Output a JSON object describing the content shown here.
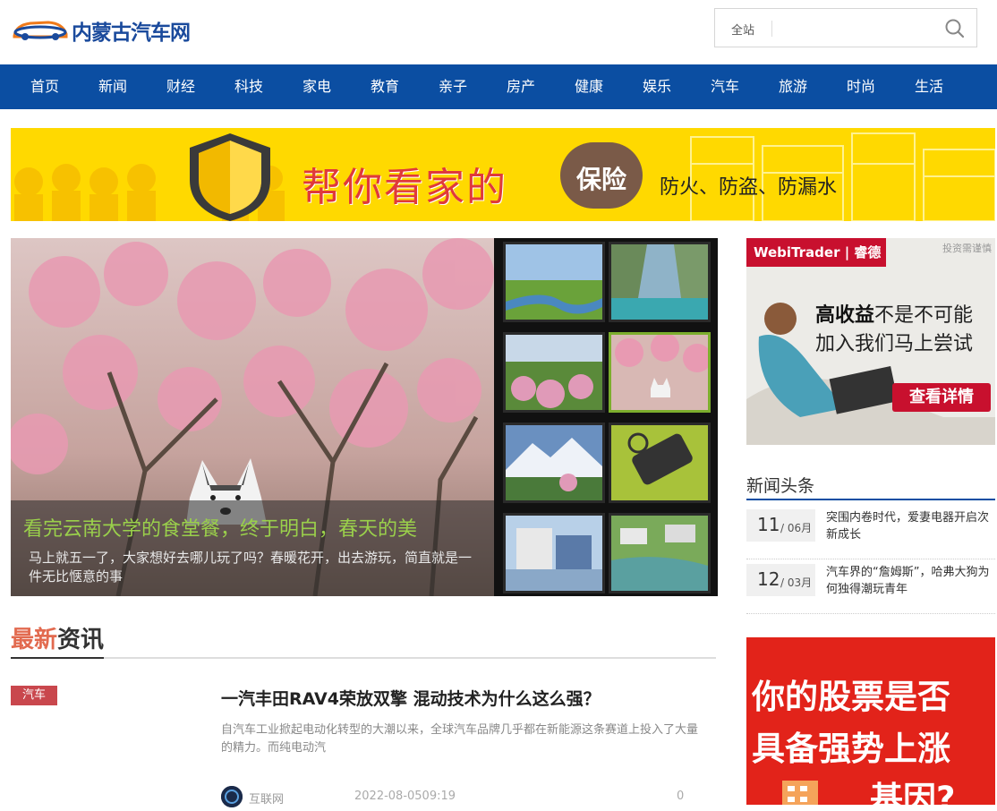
{
  "header": {
    "logo_text": "内蒙古汽车网",
    "search": {
      "scope": "全站",
      "placeholder": ""
    }
  },
  "nav": {
    "items": [
      "首页",
      "新闻",
      "财经",
      "科技",
      "家电",
      "教育",
      "亲子",
      "房产",
      "健康",
      "娱乐",
      "汽车",
      "旅游",
      "时尚",
      "生活"
    ]
  },
  "banner": {
    "title": "帮你看家的",
    "bubble": "保险",
    "subtitle": "防火、防盗、防漏水"
  },
  "slider": {
    "title": "看完云南大学的食堂餐，终于明白，春天的美",
    "description": "马上就五一了，大家想好去哪儿玩了吗？春暖花开，出去游玩，简直就是一件无比惬意的事"
  },
  "latest": {
    "heading_accent": "最新",
    "heading_rest": "资讯",
    "articles": [
      {
        "tag": "汽车",
        "title": "一汽丰田RAV4荣放双擎 混动技术为什么这么强？",
        "description": "自汽车工业掀起电动化转型的大潮以来，全球汽车品牌几乎都在新能源这条赛道上投入了大量的精力。而纯电动汽",
        "source": "互联网",
        "time": "2022-08-0509:19",
        "count": "0"
      }
    ]
  },
  "ad_right_top": {
    "brand": "WebiTrader | 睿德",
    "note": "投资需谨慎",
    "line1_bold": "高收益",
    "line1_rest": "不是不可能",
    "line2": "加入我们马上尝试",
    "button": "查看详情"
  },
  "headlines": {
    "heading": "新闻头条",
    "items": [
      {
        "day": "11",
        "month": "/ 06月",
        "title": "突围内卷时代，爱妻电器开启次新成长"
      },
      {
        "day": "12",
        "month": "/ 03月",
        "title": "汽车界的“詹姆斯”，哈弗大狗为何独得潮玩青年"
      }
    ]
  },
  "ad_right_bottom": {
    "line1": "你的股票是否",
    "line2": "具备强势上涨",
    "line3": "基因?"
  },
  "colors": {
    "nav_bg": "#0b4ea2",
    "accent_red": "#e26a4f",
    "tag_red": "#c9474d",
    "caption_green": "#9ad04b",
    "banner_yellow": "#ffd900"
  }
}
